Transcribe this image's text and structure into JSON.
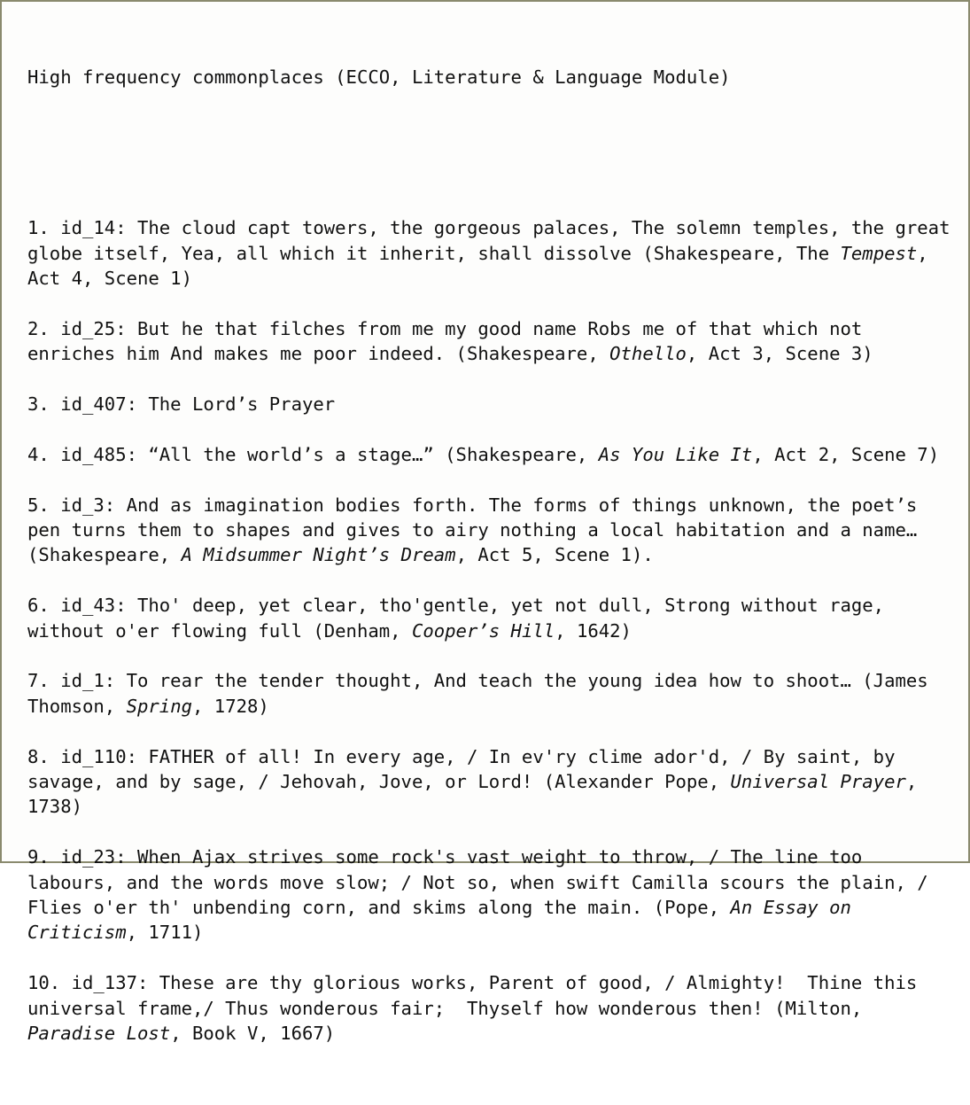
{
  "document": {
    "title": "High frequency commonplaces (ECCO, Literature & Language Module)",
    "entries": [
      {
        "number": "1.",
        "id": "id_14",
        "segments": [
          {
            "text": "1. id_14: The cloud capt towers, the gorgeous palaces, The solemn temples, the great globe itself, Yea, all which it inherit, shall dissolve (Shakespeare, The ",
            "italic": false
          },
          {
            "text": "Tempest",
            "italic": true
          },
          {
            "text": ", Act 4, Scene 1)",
            "italic": false
          }
        ]
      },
      {
        "number": "2.",
        "id": "id_25",
        "segments": [
          {
            "text": "2. id_25: But he that filches from me my good name Robs me of that which not enriches him And makes me poor indeed. (Shakespeare, ",
            "italic": false
          },
          {
            "text": "Othello",
            "italic": true
          },
          {
            "text": ", Act 3, Scene 3)",
            "italic": false
          }
        ]
      },
      {
        "number": "3.",
        "id": "id_407",
        "segments": [
          {
            "text": "3. id_407: The Lord’s Prayer",
            "italic": false
          }
        ]
      },
      {
        "number": "4.",
        "id": "id_485",
        "segments": [
          {
            "text": "4. id_485: “All the world’s a stage…” (Shakespeare, ",
            "italic": false
          },
          {
            "text": "As You Like It",
            "italic": true
          },
          {
            "text": ", Act 2, Scene 7)",
            "italic": false
          }
        ]
      },
      {
        "number": "5.",
        "id": "id_3",
        "segments": [
          {
            "text": "5. id_3: And as imagination bodies forth. The forms of things unknown, the poet’s pen turns them to shapes and gives to airy nothing a local habitation and a name… (Shakespeare, ",
            "italic": false
          },
          {
            "text": "A Midsummer Night’s Dream",
            "italic": true
          },
          {
            "text": ", Act 5, Scene 1).",
            "italic": false
          }
        ]
      },
      {
        "number": "6.",
        "id": "id_43",
        "segments": [
          {
            "text": "6. id_43: Tho' deep, yet clear, tho'gentle, yet not dull, Strong without rage, without o'er flowing full (Denham, ",
            "italic": false
          },
          {
            "text": "Cooper’s Hill",
            "italic": true
          },
          {
            "text": ", 1642)",
            "italic": false
          }
        ]
      },
      {
        "number": "7.",
        "id": "id_1",
        "segments": [
          {
            "text": "7. id_1: To rear the tender thought, And teach the young idea how to shoot… (James Thomson, ",
            "italic": false
          },
          {
            "text": "Spring",
            "italic": true
          },
          {
            "text": ", 1728)",
            "italic": false
          }
        ]
      },
      {
        "number": "8.",
        "id": "id_110",
        "segments": [
          {
            "text": "8. id_110: FATHER of all! In every age, / In ev'ry clime ador'd, / By saint, by savage, and by sage, / Jehovah, Jove, or Lord! (Alexander Pope, ",
            "italic": false
          },
          {
            "text": "Universal Prayer",
            "italic": true
          },
          {
            "text": ", 1738)",
            "italic": false
          }
        ]
      },
      {
        "number": "9.",
        "id": "id_23",
        "segments": [
          {
            "text": "9. id_23: When Ajax strives some rock's vast weight to throw, / The line too labours, and the words move slow; / Not so, when swift Camilla scours the plain, / Flies o'er th' unbending corn, and skims along the main. (Pope, ",
            "italic": false
          },
          {
            "text": "An Essay on Criticism",
            "italic": true
          },
          {
            "text": ", 1711)",
            "italic": false
          }
        ]
      },
      {
        "number": "10.",
        "id": "id_137",
        "segments": [
          {
            "text": "10. id_137: These are thy glorious works, Parent of good, / Almighty!  Thine this universal frame,/ Thus wonderous fair;  Thyself how wonderous then! (Milton, ",
            "italic": false
          },
          {
            "text": "Paradise Lost",
            "italic": true
          },
          {
            "text": ", Book V, 1667)",
            "italic": false
          }
        ]
      }
    ]
  },
  "style": {
    "border_color": "#8a8a6e",
    "background_color": "#fdfdfc",
    "text_color": "#111111"
  }
}
